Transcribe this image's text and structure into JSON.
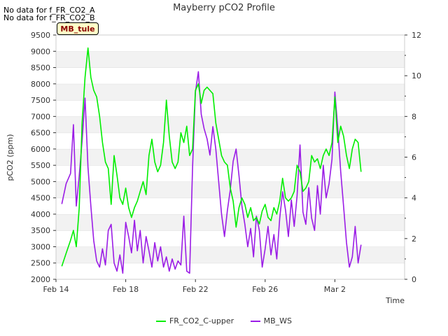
{
  "notes": [
    "No data for f_FR_CO2_A",
    "No data for f_FR_CO2_B"
  ],
  "site_tag": "MB_tule",
  "chart_data": {
    "type": "line",
    "title": "Mayberry pCO2 Profile",
    "xlabel": "Time",
    "ylabel": "pCO2 (ppm)",
    "ylim": [
      2000,
      9500
    ],
    "y_ticks": [
      2000,
      2500,
      3000,
      3500,
      4000,
      4500,
      5000,
      5500,
      6000,
      6500,
      7000,
      7500,
      8000,
      8500,
      9000,
      9500
    ],
    "y2lim": [
      0,
      12
    ],
    "y2_ticks": [
      0,
      2,
      4,
      6,
      8,
      10,
      12
    ],
    "xlim": [
      "2024-02-14",
      "2024-03-05"
    ],
    "x_ticks": [
      {
        "date": "2024-02-14",
        "label": "Feb 14"
      },
      {
        "date": "2024-02-18",
        "label": "Feb 18"
      },
      {
        "date": "2024-02-22",
        "label": "Feb 22"
      },
      {
        "date": "2024-02-26",
        "label": "Feb 26"
      },
      {
        "date": "2024-03-01",
        "label": "Mar 2"
      }
    ],
    "grid": "horizontal bands",
    "legend_position": "bottom",
    "series": [
      {
        "name": "FR_CO2_C-upper",
        "color": "#00ee00",
        "axis": "left",
        "points": [
          [
            "2024-02-14T08:00",
            2400
          ],
          [
            "2024-02-14T14:00",
            2800
          ],
          [
            "2024-02-14T20:00",
            3200
          ],
          [
            "2024-02-15T00:00",
            3500
          ],
          [
            "2024-02-15T04:00",
            3000
          ],
          [
            "2024-02-15T08:00",
            4200
          ],
          [
            "2024-02-15T12:00",
            6800
          ],
          [
            "2024-02-15T16:00",
            8200
          ],
          [
            "2024-02-15T20:00",
            9100
          ],
          [
            "2024-02-16T00:00",
            8200
          ],
          [
            "2024-02-16T04:00",
            7800
          ],
          [
            "2024-02-16T08:00",
            7600
          ],
          [
            "2024-02-16T12:00",
            7000
          ],
          [
            "2024-02-16T16:00",
            6200
          ],
          [
            "2024-02-16T20:00",
            5600
          ],
          [
            "2024-02-17T00:00",
            5400
          ],
          [
            "2024-02-17T04:00",
            4300
          ],
          [
            "2024-02-17T08:00",
            5800
          ],
          [
            "2024-02-17T12:00",
            5200
          ],
          [
            "2024-02-17T16:00",
            4500
          ],
          [
            "2024-02-17T20:00",
            4300
          ],
          [
            "2024-02-18T00:00",
            4800
          ],
          [
            "2024-02-18T04:00",
            4200
          ],
          [
            "2024-02-18T08:00",
            3900
          ],
          [
            "2024-02-18T12:00",
            4200
          ],
          [
            "2024-02-18T16:00",
            4400
          ],
          [
            "2024-02-18T20:00",
            4700
          ],
          [
            "2024-02-19T00:00",
            5000
          ],
          [
            "2024-02-19T04:00",
            4600
          ],
          [
            "2024-02-19T08:00",
            5800
          ],
          [
            "2024-02-19T12:00",
            6300
          ],
          [
            "2024-02-19T16:00",
            5600
          ],
          [
            "2024-02-19T20:00",
            5300
          ],
          [
            "2024-02-20T00:00",
            5500
          ],
          [
            "2024-02-20T04:00",
            6200
          ],
          [
            "2024-02-20T08:00",
            7500
          ],
          [
            "2024-02-20T12:00",
            6400
          ],
          [
            "2024-02-20T16:00",
            5600
          ],
          [
            "2024-02-20T20:00",
            5400
          ],
          [
            "2024-02-21T00:00",
            5600
          ],
          [
            "2024-02-21T04:00",
            6500
          ],
          [
            "2024-02-21T08:00",
            6200
          ],
          [
            "2024-02-21T12:00",
            6700
          ],
          [
            "2024-02-21T16:00",
            5800
          ],
          [
            "2024-02-21T20:00",
            6000
          ],
          [
            "2024-02-22T00:00",
            7800
          ],
          [
            "2024-02-22T04:00",
            8000
          ],
          [
            "2024-02-22T08:00",
            7400
          ],
          [
            "2024-02-22T12:00",
            7800
          ],
          [
            "2024-02-22T16:00",
            7900
          ],
          [
            "2024-02-22T20:00",
            7800
          ],
          [
            "2024-02-23T00:00",
            7700
          ],
          [
            "2024-02-23T04:00",
            6800
          ],
          [
            "2024-02-23T08:00",
            6300
          ],
          [
            "2024-02-23T12:00",
            5800
          ],
          [
            "2024-02-23T16:00",
            5600
          ],
          [
            "2024-02-23T20:00",
            5500
          ],
          [
            "2024-02-24T00:00",
            4800
          ],
          [
            "2024-02-24T04:00",
            4400
          ],
          [
            "2024-02-24T08:00",
            3600
          ],
          [
            "2024-02-24T12:00",
            4200
          ],
          [
            "2024-02-24T16:00",
            4500
          ],
          [
            "2024-02-24T20:00",
            4300
          ],
          [
            "2024-02-25T00:00",
            3900
          ],
          [
            "2024-02-25T04:00",
            4200
          ],
          [
            "2024-02-25T08:00",
            3800
          ],
          [
            "2024-02-25T12:00",
            3900
          ],
          [
            "2024-02-25T16:00",
            3700
          ],
          [
            "2024-02-25T20:00",
            4100
          ],
          [
            "2024-02-26T00:00",
            4300
          ],
          [
            "2024-02-26T04:00",
            3900
          ],
          [
            "2024-02-26T08:00",
            3800
          ],
          [
            "2024-02-26T12:00",
            4200
          ],
          [
            "2024-02-26T16:00",
            4000
          ],
          [
            "2024-02-26T20:00",
            4400
          ],
          [
            "2024-02-27T00:00",
            5100
          ],
          [
            "2024-02-27T04:00",
            4500
          ],
          [
            "2024-02-27T08:00",
            4400
          ],
          [
            "2024-02-27T12:00",
            4500
          ],
          [
            "2024-02-27T16:00",
            4700
          ],
          [
            "2024-02-27T20:00",
            5500
          ],
          [
            "2024-02-28T00:00",
            5300
          ],
          [
            "2024-02-28T04:00",
            4700
          ],
          [
            "2024-02-28T08:00",
            4800
          ],
          [
            "2024-02-28T12:00",
            5000
          ],
          [
            "2024-02-28T16:00",
            5800
          ],
          [
            "2024-02-28T20:00",
            5600
          ],
          [
            "2024-02-29T00:00",
            5700
          ],
          [
            "2024-02-29T04:00",
            5400
          ],
          [
            "2024-02-29T08:00",
            5800
          ],
          [
            "2024-02-29T12:00",
            6000
          ],
          [
            "2024-02-29T16:00",
            5800
          ],
          [
            "2024-02-29T20:00",
            6200
          ],
          [
            "2024-03-01T00:00",
            7600
          ],
          [
            "2024-03-01T04:00",
            6200
          ],
          [
            "2024-03-01T08:00",
            6700
          ],
          [
            "2024-03-01T12:00",
            6400
          ],
          [
            "2024-03-01T16:00",
            5800
          ],
          [
            "2024-03-01T20:00",
            5400
          ],
          [
            "2024-03-02T00:00",
            6000
          ],
          [
            "2024-03-02T04:00",
            6300
          ],
          [
            "2024-03-02T08:00",
            6200
          ],
          [
            "2024-03-02T12:00",
            5300
          ]
        ]
      },
      {
        "name": "MB_WS",
        "color": "#9b1de6",
        "axis": "right",
        "points": [
          [
            "2024-02-14T08:00",
            3.7
          ],
          [
            "2024-02-14T14:00",
            4.7
          ],
          [
            "2024-02-14T20:00",
            5.2
          ],
          [
            "2024-02-15T00:00",
            7.6
          ],
          [
            "2024-02-15T04:00",
            3.6
          ],
          [
            "2024-02-15T08:00",
            5.1
          ],
          [
            "2024-02-15T12:00",
            6.8
          ],
          [
            "2024-02-15T16:00",
            8.9
          ],
          [
            "2024-02-15T20:00",
            5.5
          ],
          [
            "2024-02-16T00:00",
            3.6
          ],
          [
            "2024-02-16T04:00",
            1.9
          ],
          [
            "2024-02-16T08:00",
            0.9
          ],
          [
            "2024-02-16T12:00",
            0.6
          ],
          [
            "2024-02-16T16:00",
            1.5
          ],
          [
            "2024-02-16T20:00",
            0.7
          ],
          [
            "2024-02-17T00:00",
            2.4
          ],
          [
            "2024-02-17T04:00",
            2.7
          ],
          [
            "2024-02-17T08:00",
            0.8
          ],
          [
            "2024-02-17T12:00",
            0.4
          ],
          [
            "2024-02-17T16:00",
            1.2
          ],
          [
            "2024-02-17T20:00",
            0.3
          ],
          [
            "2024-02-18T00:00",
            2.8
          ],
          [
            "2024-02-18T04:00",
            2.1
          ],
          [
            "2024-02-18T08:00",
            1.3
          ],
          [
            "2024-02-18T12:00",
            2.9
          ],
          [
            "2024-02-18T16:00",
            1.4
          ],
          [
            "2024-02-18T20:00",
            2.4
          ],
          [
            "2024-02-19T00:00",
            0.8
          ],
          [
            "2024-02-19T04:00",
            2.1
          ],
          [
            "2024-02-19T08:00",
            1.4
          ],
          [
            "2024-02-19T12:00",
            0.6
          ],
          [
            "2024-02-19T16:00",
            1.8
          ],
          [
            "2024-02-19T20:00",
            0.9
          ],
          [
            "2024-02-20T00:00",
            1.6
          ],
          [
            "2024-02-20T04:00",
            0.6
          ],
          [
            "2024-02-20T08:00",
            1.1
          ],
          [
            "2024-02-20T12:00",
            0.4
          ],
          [
            "2024-02-20T16:00",
            1.0
          ],
          [
            "2024-02-20T20:00",
            0.5
          ],
          [
            "2024-02-21T00:00",
            0.9
          ],
          [
            "2024-02-21T04:00",
            0.7
          ],
          [
            "2024-02-21T08:00",
            3.1
          ],
          [
            "2024-02-21T12:00",
            0.4
          ],
          [
            "2024-02-21T16:00",
            0.3
          ],
          [
            "2024-02-21T20:00",
            5.5
          ],
          [
            "2024-02-22T00:00",
            9.2
          ],
          [
            "2024-02-22T04:00",
            10.2
          ],
          [
            "2024-02-22T08:00",
            8.1
          ],
          [
            "2024-02-22T12:00",
            7.4
          ],
          [
            "2024-02-22T16:00",
            6.9
          ],
          [
            "2024-02-22T20:00",
            6.1
          ],
          [
            "2024-02-23T00:00",
            7.5
          ],
          [
            "2024-02-23T04:00",
            6.4
          ],
          [
            "2024-02-23T08:00",
            4.8
          ],
          [
            "2024-02-23T12:00",
            3.2
          ],
          [
            "2024-02-23T16:00",
            2.1
          ],
          [
            "2024-02-23T20:00",
            3.4
          ],
          [
            "2024-02-24T00:00",
            4.4
          ],
          [
            "2024-02-24T04:00",
            5.8
          ],
          [
            "2024-02-24T08:00",
            6.4
          ],
          [
            "2024-02-24T12:00",
            5.1
          ],
          [
            "2024-02-24T16:00",
            3.6
          ],
          [
            "2024-02-24T20:00",
            2.7
          ],
          [
            "2024-02-25T00:00",
            1.6
          ],
          [
            "2024-02-25T04:00",
            2.5
          ],
          [
            "2024-02-25T08:00",
            1.1
          ],
          [
            "2024-02-25T12:00",
            3.1
          ],
          [
            "2024-02-25T16:00",
            2.4
          ],
          [
            "2024-02-25T20:00",
            0.6
          ],
          [
            "2024-02-26T00:00",
            1.5
          ],
          [
            "2024-02-26T04:00",
            2.6
          ],
          [
            "2024-02-26T08:00",
            1.2
          ],
          [
            "2024-02-26T12:00",
            2.2
          ],
          [
            "2024-02-26T16:00",
            1.0
          ],
          [
            "2024-02-26T20:00",
            3.0
          ],
          [
            "2024-02-27T00:00",
            4.3
          ],
          [
            "2024-02-27T04:00",
            3.4
          ],
          [
            "2024-02-27T08:00",
            2.1
          ],
          [
            "2024-02-27T12:00",
            3.9
          ],
          [
            "2024-02-27T16:00",
            2.6
          ],
          [
            "2024-02-27T20:00",
            4.1
          ],
          [
            "2024-02-28T00:00",
            6.6
          ],
          [
            "2024-02-28T04:00",
            3.3
          ],
          [
            "2024-02-28T08:00",
            2.7
          ],
          [
            "2024-02-28T12:00",
            4.5
          ],
          [
            "2024-02-28T16:00",
            3.0
          ],
          [
            "2024-02-28T20:00",
            2.4
          ],
          [
            "2024-02-29T00:00",
            4.6
          ],
          [
            "2024-02-29T04:00",
            3.2
          ],
          [
            "2024-02-29T08:00",
            5.6
          ],
          [
            "2024-02-29T12:00",
            4.0
          ],
          [
            "2024-02-29T16:00",
            4.7
          ],
          [
            "2024-02-29T20:00",
            5.9
          ],
          [
            "2024-03-01T00:00",
            9.2
          ],
          [
            "2024-03-01T04:00",
            7.4
          ],
          [
            "2024-03-01T08:00",
            5.3
          ],
          [
            "2024-03-01T12:00",
            3.6
          ],
          [
            "2024-03-01T16:00",
            1.8
          ],
          [
            "2024-03-01T20:00",
            0.6
          ],
          [
            "2024-03-02T00:00",
            1.1
          ],
          [
            "2024-03-02T04:00",
            2.6
          ],
          [
            "2024-03-02T08:00",
            0.8
          ],
          [
            "2024-03-02T12:00",
            1.7
          ]
        ]
      }
    ]
  }
}
